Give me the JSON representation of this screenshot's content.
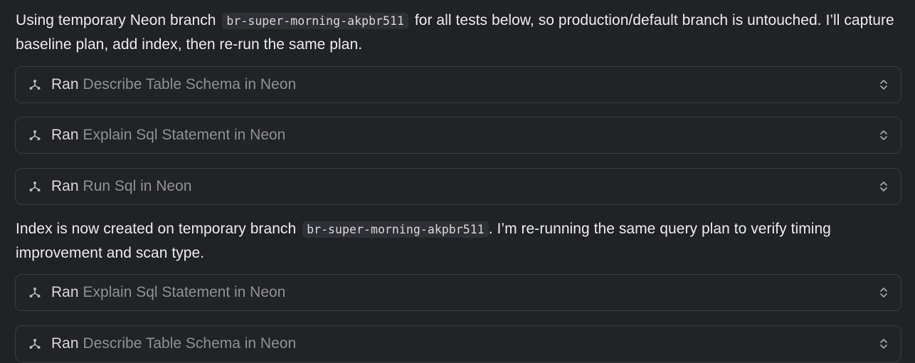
{
  "messages": [
    {
      "before": "Using temporary Neon branch",
      "code": "br-super-morning-akpbr511",
      "after": "for all tests below, so production/default branch is untouched. I’ll capture baseline plan, add index, then re-run the same plan."
    },
    {
      "before": "Index is now created on temporary branch",
      "code": "br-super-morning-akpbr511",
      "after": ". I’m re-running the same query plan to verify timing improvement and scan type."
    }
  ],
  "tool_calls": [
    {
      "prefix": "Ran",
      "name": "Describe Table Schema in Neon",
      "icon": "tool-network-icon"
    },
    {
      "prefix": "Ran",
      "name": "Explain Sql Statement in Neon",
      "icon": "tool-network-icon"
    },
    {
      "prefix": "Ran",
      "name": "Run Sql in Neon",
      "icon": "tool-network-icon"
    },
    {
      "prefix": "Ran",
      "name": "Explain Sql Statement in Neon",
      "icon": "tool-network-icon"
    },
    {
      "prefix": "Ran",
      "name": "Describe Table Schema in Neon",
      "icon": "tool-network-icon"
    }
  ],
  "colors": {
    "background": "#212226",
    "text": "#ececee",
    "muted": "#8f9096",
    "border": "#3a3b40",
    "code_bg": "#2f3035"
  }
}
